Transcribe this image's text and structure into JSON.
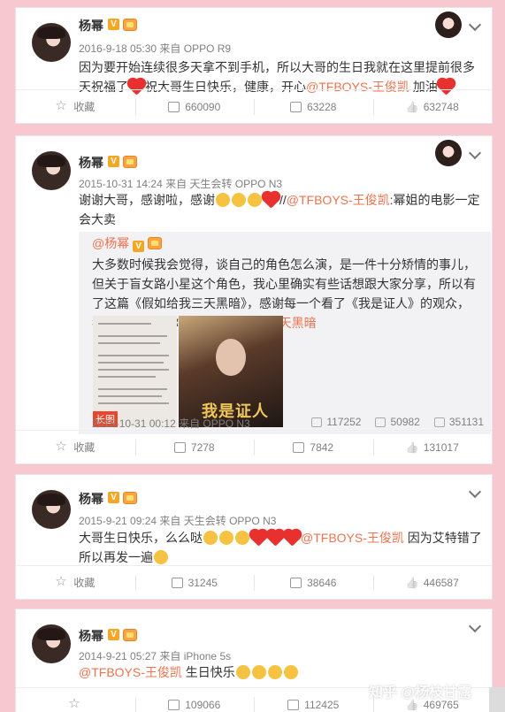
{
  "posts": [
    {
      "author": "杨幂",
      "meta": "2016-9-18 05:30 来自 OPPO R9",
      "text_before": "因为要开始连续很多天拿不到手机，所以大哥的生日我就在这里提前很多天祝福了",
      "text_mid": "祝大哥生日快乐，健康，开心",
      "mention": "@TFBOYS-王俊凯",
      "text_after": " 加油",
      "actions": {
        "favorite": "收藏",
        "reposts": "660090",
        "comments": "63228",
        "likes": "632748"
      }
    },
    {
      "author": "杨幂",
      "meta_time": "2015-10-31 14:24 来自 ",
      "meta_source": "天生会转 OPPO N3",
      "text_before": "谢谢大哥，感谢啦，感谢",
      "text_sep": "//",
      "mention": "@TFBOYS-王俊凯",
      "text_after": ":幂姐的电影一定会大卖",
      "repost": {
        "author": "@杨幂",
        "text": "大多数时候我会觉得，谈自己的角色怎么演，是一件十分矫情的事儿，但关于盲女路小星这个角色，我心里确实有些话想跟大家分享，所以有了这篇《假如给我三天黑暗》，感谢每一个看了《我是证人》的观众，我的感受，与你分享",
        "link": "假如给我三天黑暗",
        "image_tag": "长图",
        "poster_title": "我是证人",
        "meta": "2015-10-31 00:12 来自 OPPO N3",
        "reposts": "117252",
        "comments": "50982",
        "likes": "351131"
      },
      "actions": {
        "favorite": "收藏",
        "reposts": "7278",
        "comments": "7842",
        "likes": "131017"
      }
    },
    {
      "author": "杨幂",
      "meta_time": "2015-9-21 09:24 来自 ",
      "meta_source": "天生会转 OPPO N3",
      "text_before": "大哥生日快乐，么么哒",
      "mention": "@TFBOYS-王俊凯",
      "text_after": " 因为艾特错了所以再发一遍",
      "actions": {
        "favorite": "收藏",
        "reposts": "31245",
        "comments": "38646",
        "likes": "446587"
      }
    },
    {
      "author": "杨幂",
      "meta": "2014-9-21 05:27 来自 iPhone 5s",
      "mention": "@TFBOYS-王俊凯",
      "text_after": " 生日快乐",
      "actions": {
        "reposts": "109066",
        "comments": "112425",
        "likes": "469765"
      }
    }
  ],
  "watermark": "知乎 @杨枝甘露",
  "colors": {
    "background": "#f7c8cf",
    "link": "#eb7350",
    "meta": "#808080"
  }
}
